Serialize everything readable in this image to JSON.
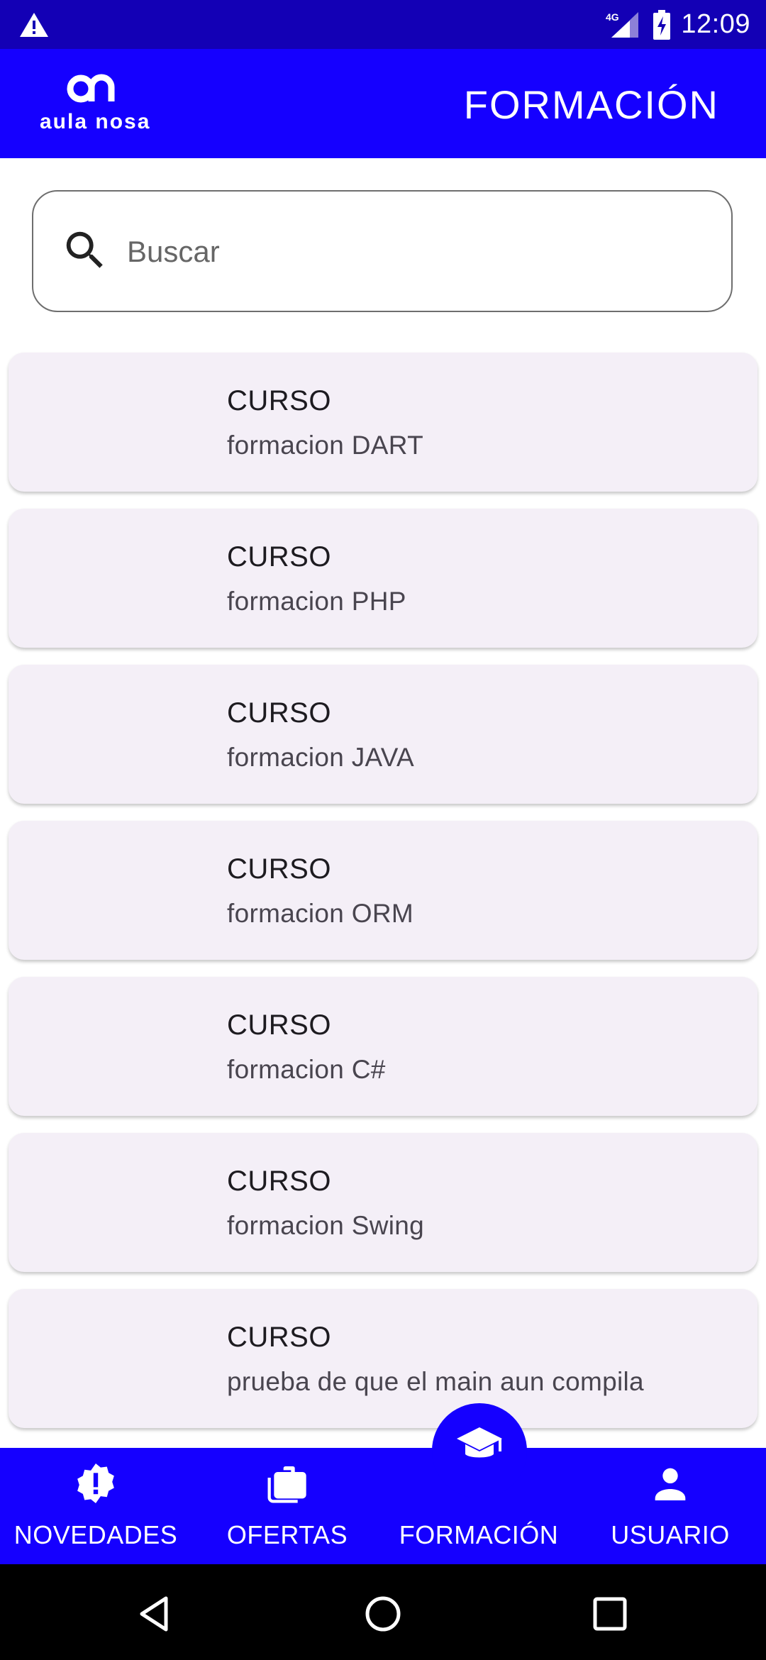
{
  "status_bar": {
    "network": "4G",
    "time": "12:09"
  },
  "app_bar": {
    "logo_text": "aula nosa",
    "title": "FORMACIÓN"
  },
  "search": {
    "placeholder": "Buscar"
  },
  "courses": [
    {
      "kind": "CURSO",
      "name": "formacion DART"
    },
    {
      "kind": "CURSO",
      "name": "formacion PHP"
    },
    {
      "kind": "CURSO",
      "name": "formacion JAVA"
    },
    {
      "kind": "CURSO",
      "name": "formacion ORM"
    },
    {
      "kind": "CURSO",
      "name": "formacion C#"
    },
    {
      "kind": "CURSO",
      "name": "formacion Swing"
    },
    {
      "kind": "CURSO",
      "name": "prueba de que el main aun compila"
    }
  ],
  "bottom_nav": {
    "items": [
      {
        "label": "NOVEDADES",
        "icon": "alert-badge-icon"
      },
      {
        "label": "OFERTAS",
        "icon": "briefcase-icon"
      },
      {
        "label": "FORMACIÓN",
        "icon": "graduation-cap-icon",
        "selected": true
      },
      {
        "label": "USUARIO",
        "icon": "person-icon"
      }
    ]
  },
  "colors": {
    "status_bar": "#1300b5",
    "primary": "#1500ff",
    "card_bg": "#f4eff7"
  }
}
